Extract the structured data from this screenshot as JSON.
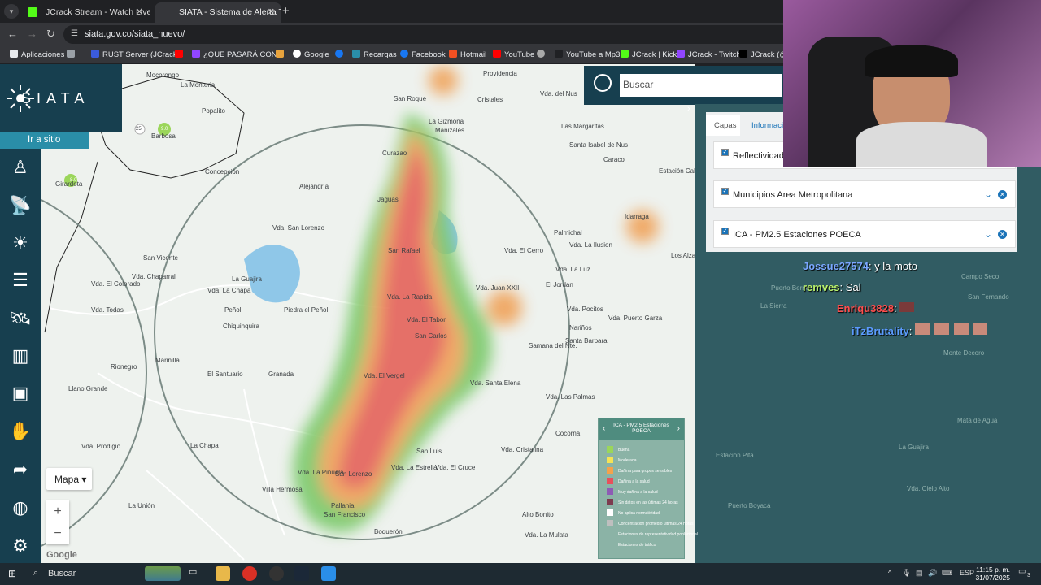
{
  "browser": {
    "tabs": [
      {
        "title": "JCrack Stream - Watch Live on Kick",
        "favicon_color": "#53fc18",
        "active": false
      },
      {
        "title": "SIATA - Sistema de Alerta Temprana",
        "favicon_color": "#2a8ea8",
        "active": true
      }
    ],
    "new_tab_label": "+",
    "url": "siata.gov.co/siata_nuevo/",
    "bookmarks": [
      {
        "label": "Aplicaciones",
        "color": "#e8eaed"
      },
      {
        "label": "RUST Server (JCrack...",
        "color": "#3b5bdb"
      },
      {
        "label": "",
        "color": "#ff0000"
      },
      {
        "label": "¿QUE PASARÁ CON...",
        "color": "#9146ff"
      },
      {
        "label": "",
        "color": "#e8a33d"
      },
      {
        "label": "Google",
        "color": "#ffffff"
      },
      {
        "label": "",
        "color": "#1877f2"
      },
      {
        "label": "Recargas",
        "color": "#2a8ea8"
      },
      {
        "label": "Facebook",
        "color": "#1877f2"
      },
      {
        "label": "Hotmail",
        "color": "#f25022"
      },
      {
        "label": "YouTube",
        "color": "#ff0000"
      },
      {
        "label": "",
        "color": "#aaaaaa"
      },
      {
        "label": "YouTube a Mp3",
        "color": "#202124"
      },
      {
        "label": "JCrack | Kick",
        "color": "#53fc18"
      },
      {
        "label": "JCrack - Twitch",
        "color": "#9146ff"
      },
      {
        "label": "JCrack (@J...",
        "color": "#000000"
      }
    ]
  },
  "siata": {
    "logo": "SIATA",
    "go_to_site": "Ir a sitio",
    "search_placeholder": "Buscar",
    "panel_tabs": [
      "Capas",
      "Información"
    ],
    "layers": [
      {
        "name": "Reflectividad",
        "checked": true
      },
      {
        "name": "Municipios Area Metropolitana",
        "checked": true
      },
      {
        "name": "ICA - PM2.5 Estaciones POECA",
        "checked": true
      }
    ],
    "map_type_button": "Mapa",
    "zoom_in": "+",
    "zoom_out": "−",
    "attribution": "Google",
    "legend": {
      "title": "ICA - PM2.5 Estaciones POECA",
      "items": [
        {
          "label": "Buena",
          "color": "#9bd65a"
        },
        {
          "label": "Moderada",
          "color": "#f5e356"
        },
        {
          "label": "Dañina para grupos sensibles",
          "color": "#f5a24b"
        },
        {
          "label": "Dañina a la salud",
          "color": "#e8505b"
        },
        {
          "label": "Muy dañina a la salud",
          "color": "#8e5bb5"
        },
        {
          "label": "Sin datos en las últimas 24 horas",
          "color": "#7d3b4f"
        },
        {
          "label": "No aplica normatividad",
          "color": "#ffffff"
        },
        {
          "label": "Concentración promedio últimas 24 horas",
          "color": "#bfbfbf"
        },
        {
          "label": "Estaciones de representatividad poblacional",
          "color": "#8bb3a6"
        },
        {
          "label": "Estaciones de tráfico",
          "color": "#8bb3a6"
        }
      ]
    },
    "places": [
      "Mocorongo",
      "La Monteria",
      "Popalito",
      "Barbosa",
      "Concepción",
      "Girardota",
      "Alejandría",
      "San Roque",
      "Cristales",
      "Providencia",
      "Vda. del Nus",
      "La Gizmona",
      "Manizales",
      "Las Margaritas",
      "Santa Isabel de Nus",
      "Caracol",
      "Estación Cabañas",
      "Curazao",
      "Jaguas",
      "Idarraga",
      "Vda. San Lorenzo",
      "San Rafael",
      "Palmichal",
      "Vda. La Ilusion",
      "Vda. El Cerro",
      "Los Alzates",
      "San Vicente",
      "Vda. Chaparral",
      "La Guajira",
      "Vda. La Luz",
      "El Jordan",
      "Vda. El Colorado",
      "Vda. La Chapa",
      "Vda. Juan XXIII",
      "Vda. Todas",
      "Peñol",
      "Piedra el Peñol",
      "Vda. La Rapida",
      "Vda. El Tabor",
      "Vda. Pocitos",
      "Vda. Puerto Garza",
      "Chiquinquira",
      "San Carlos",
      "Nariños",
      "Samana del Nte.",
      "Santa Barbara",
      "Marinilla",
      "Rionegro",
      "El Santuario",
      "Granada",
      "Vda. El Vergel",
      "Vda. Santa Elena",
      "Llano Grande",
      "Vda. Las Palmas",
      "Cocorná",
      "Vda. Prodigio",
      "La Chapa",
      "San Luis",
      "Vda. Cristalina",
      "Vda. La Piñuela",
      "San Lorenzo",
      "Vda. La Estrella",
      "Vda. El Cruce",
      "Villa Hermosa",
      "La Unión",
      "Pallania",
      "San Francisco",
      "Alto Bonito",
      "Boquerón",
      "Vda. La Mulata"
    ],
    "station_badges": [
      "8.0",
      "9.0",
      "25"
    ]
  },
  "stream_chat": [
    {
      "user": "Jossue27574",
      "user_color": "#7aa7ff",
      "message": ": y la moto"
    },
    {
      "user": "remves",
      "user_color": "#b8f06b",
      "message": ": Sal"
    },
    {
      "user": "Enriqu3828",
      "user_color": "#ff4d4d",
      "message": ":"
    },
    {
      "user": "iTzBrutality",
      "user_color": "#5b9bff",
      "message": ":"
    }
  ],
  "right_map_places": [
    "Campo Seco",
    "Puerto Berrio",
    "La Sierra",
    "Monte Decoro",
    "Estación Pita",
    "Mata de Agua",
    "La Guajira",
    "Vda. Cielo Alto",
    "San Fernando",
    "Puerto Boyacá"
  ],
  "taskbar": {
    "search_label": "Buscar",
    "language": "ESP",
    "time": "11:15 p. m.",
    "date": "31/07/2025",
    "notifications": "3"
  }
}
